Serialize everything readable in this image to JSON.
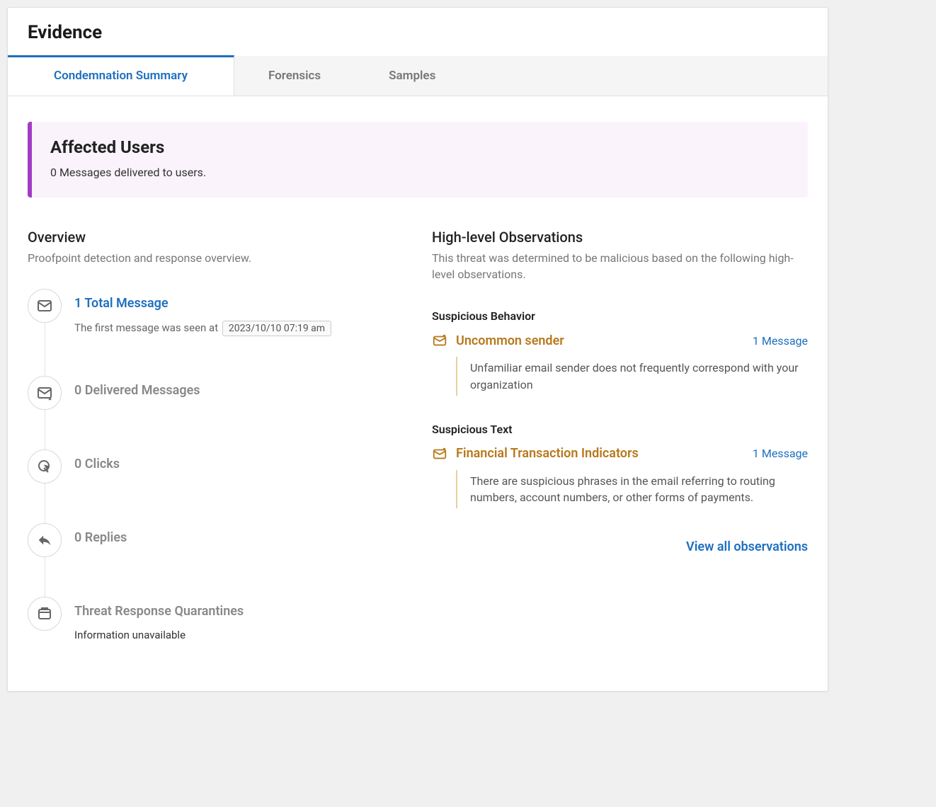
{
  "header": {
    "title": "Evidence"
  },
  "tabs": [
    {
      "label": "Condemnation Summary",
      "active": true
    },
    {
      "label": "Forensics",
      "active": false
    },
    {
      "label": "Samples",
      "active": false
    }
  ],
  "alert": {
    "title": "Affected Users",
    "subtitle": "0 Messages delivered to users."
  },
  "overview": {
    "heading": "Overview",
    "subheading": "Proofpoint detection and response overview.",
    "items": [
      {
        "icon": "mail-icon",
        "title": "1 Total Message",
        "accent": true,
        "sub_prefix": "The first message was seen at",
        "timestamp": "2023/10/10 07:19 am"
      },
      {
        "icon": "mail-alert-icon",
        "title": "0 Delivered Messages"
      },
      {
        "icon": "click-icon",
        "title": "0 Clicks"
      },
      {
        "icon": "reply-icon",
        "title": "0 Replies"
      },
      {
        "icon": "quarantine-icon",
        "title": "Threat Response Quarantines",
        "sub_plain": "Information unavailable"
      }
    ]
  },
  "observations": {
    "heading": "High-level Observations",
    "subheading": "This threat was determined to be malicious based on the following high-level observations.",
    "groups": [
      {
        "group_title": "Suspicious Behavior",
        "title": "Uncommon sender",
        "count": "1 Message",
        "description": "Unfamiliar email sender does not frequently correspond with your organization"
      },
      {
        "group_title": "Suspicious Text",
        "title": "Financial Transaction Indicators",
        "count": "1 Message",
        "description": "There are suspicious phrases in the email referring to routing numbers, account numbers, or other forms of payments."
      }
    ],
    "view_all_label": "View all observations"
  }
}
